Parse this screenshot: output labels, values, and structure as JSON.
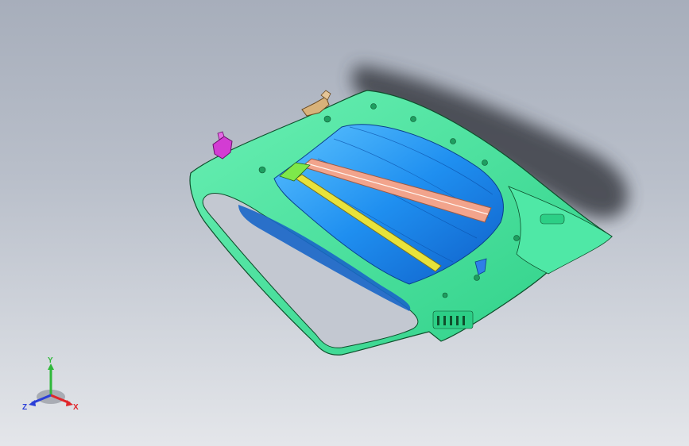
{
  "viewport": {
    "background_top": "#a7aebb",
    "background_bottom": "#e4e6ea"
  },
  "model": {
    "frame_color": "#39e39a",
    "frame_outline": "#0f4f2c",
    "panel_color": "#1f8ff0",
    "beam_color": "#f2a48c",
    "rail_color": "#e8e23a",
    "bracket_magenta": "#d33cd3",
    "bracket_tan": "#d8b27a",
    "shadow_color": "#3a3d44"
  },
  "triad": {
    "y_label": "Y",
    "x_label": "X",
    "z_label": "Z",
    "y_color": "#2fb83a",
    "x_color": "#e0262b",
    "z_color": "#2b3fd8"
  }
}
